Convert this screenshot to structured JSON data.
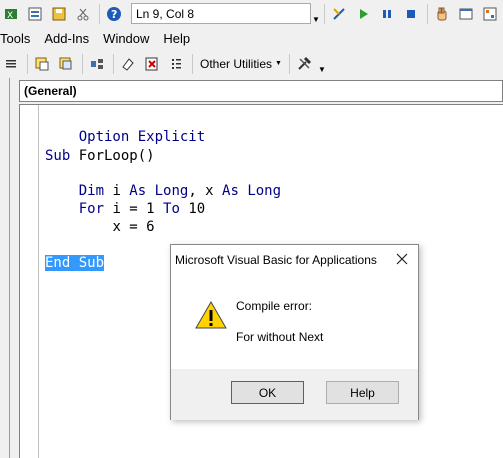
{
  "toolbar_top": {
    "position_text": "Ln 9, Col 8",
    "icons": [
      "view-excel-icon",
      "insert-module-icon",
      "save-icon",
      "cut-icon",
      "help-icon",
      "design-mode-icon",
      "run-icon",
      "pause-icon",
      "stop-icon",
      "hand-icon",
      "properties-icon",
      "object-browser-icon"
    ]
  },
  "menubar": {
    "items": [
      "Tools",
      "Add-Ins",
      "Window",
      "Help"
    ]
  },
  "toolbar_edit": {
    "other_utilities_label": "Other Utilities",
    "icons": [
      "list-icon",
      "indent-icon",
      "outdent-icon",
      "block-icon",
      "eraser-icon",
      "bookmark-icon",
      "list-members-icon",
      "tools-icon"
    ]
  },
  "editor": {
    "object_combo": "(General)",
    "lines": {
      "l1_kw": "Option Explicit",
      "l3_kw": "Sub ",
      "l3_rest": "ForLoop()",
      "l5_kw1": "Dim ",
      "l5_t1": "i ",
      "l5_kw2": "As Long",
      "l5_t2": ", x ",
      "l5_kw3": "As Long",
      "l6_kw1": "For ",
      "l6_t1": "i = 1 ",
      "l6_kw2": "To ",
      "l6_t2": "10",
      "l7": "x = 6",
      "l9_sel": "End Sub"
    },
    "colors": {
      "keyword": "#00008b",
      "selection": "#3399ff"
    }
  },
  "dialog": {
    "title": "Microsoft Visual Basic for Applications",
    "message_heading": "Compile error:",
    "message_detail": "For without Next",
    "ok_label": "OK",
    "help_label": "Help",
    "icon": "warning-icon"
  }
}
